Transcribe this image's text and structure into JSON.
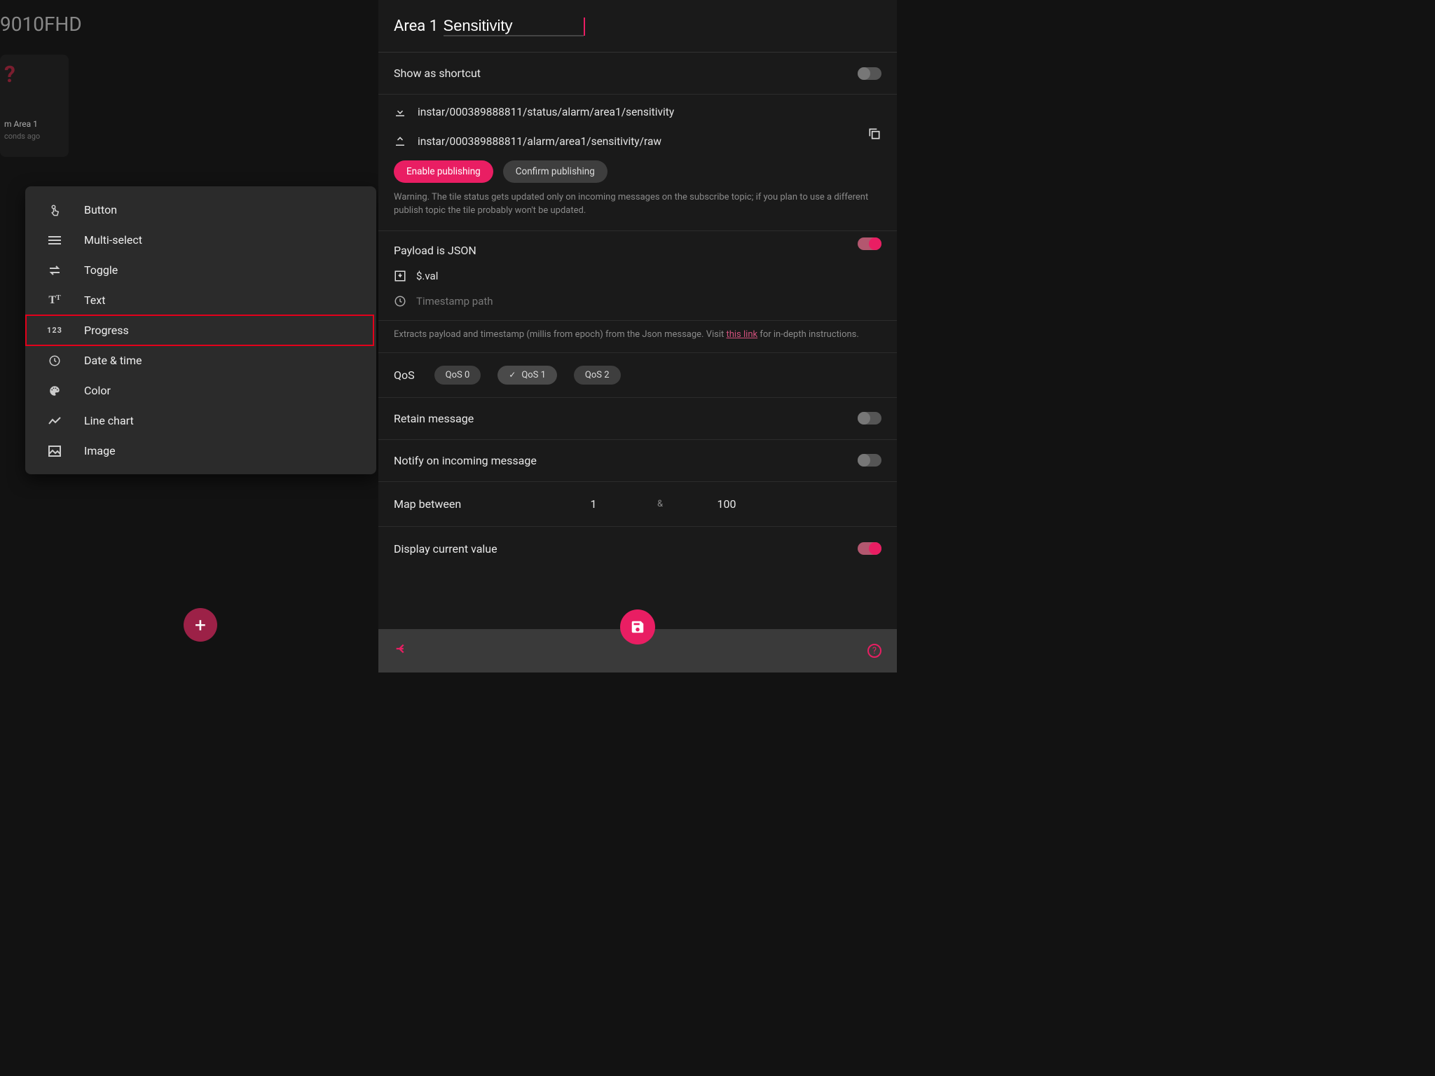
{
  "left": {
    "title": "9010FHD",
    "card": {
      "line1": "m Area 1",
      "line2": "conds ago"
    }
  },
  "menu": [
    {
      "label": "Button"
    },
    {
      "label": "Multi-select"
    },
    {
      "label": "Toggle"
    },
    {
      "label": "Text"
    },
    {
      "label": "Progress"
    },
    {
      "label": "Date & time"
    },
    {
      "label": "Color"
    },
    {
      "label": "Line chart"
    },
    {
      "label": "Image"
    }
  ],
  "panel": {
    "title_prefix": "Area 1 ",
    "title_value": "Sensitivity",
    "shortcut_label": "Show as shortcut",
    "subscribe_topic": "instar/000389888811/status/alarm/area1/sensitivity",
    "publish_topic": "instar/000389888811/alarm/area1/sensitivity/raw",
    "enable_pub": "Enable publishing",
    "confirm_pub": "Confirm publishing",
    "warn": "Warning. The tile status gets updated only on incoming messages on the subscribe topic; if you plan to use a different publish topic the tile probably won't be updated.",
    "json_label": "Payload is JSON",
    "json_path": "$.val",
    "timestamp_placeholder": "Timestamp path",
    "json_help_pre": "Extracts payload and timestamp (millis from epoch) from the Json message. Visit ",
    "json_help_link": "this link",
    "json_help_post": " for in-depth instructions.",
    "qos_label": "QoS",
    "qos0": "QoS 0",
    "qos1": "QoS 1",
    "qos2": "QoS 2",
    "retain_label": "Retain message",
    "notify_label": "Notify on incoming message",
    "map_label": "Map between",
    "map_from": "1",
    "map_amp": "&",
    "map_to": "100",
    "display_label": "Display current value"
  }
}
